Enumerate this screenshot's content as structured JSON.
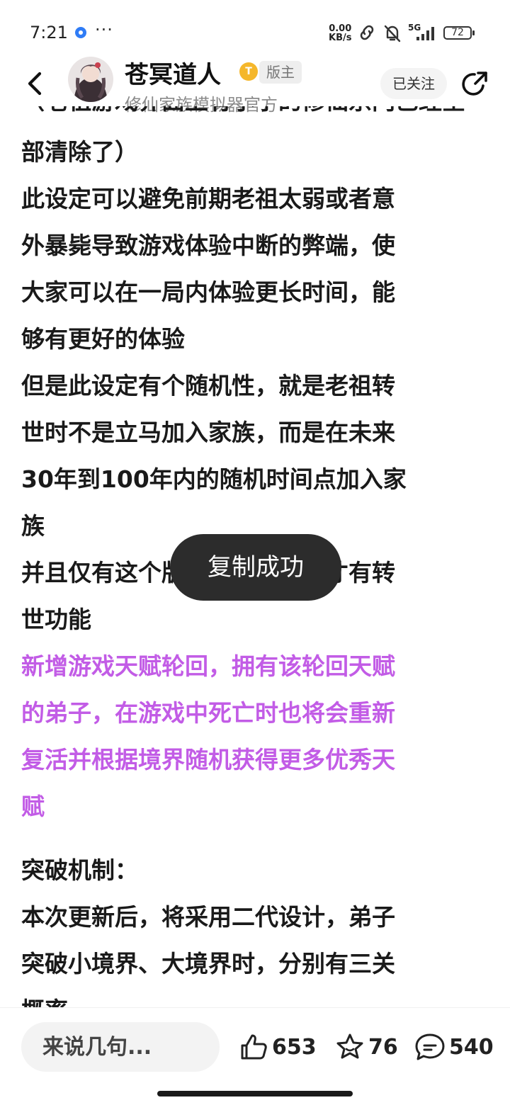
{
  "status_bar": {
    "time": "7:21",
    "net_speed_value": "0.00",
    "net_speed_unit": "KB/s",
    "network_type": "5G",
    "battery": "72"
  },
  "header": {
    "author_name": "苍冥道人",
    "coin_badge": "T",
    "role_badge": "版主",
    "author_subtitle": "修仙家族模拟器官方",
    "follow_label": "已关注"
  },
  "article": {
    "paragraphs": [
      "（老祖游戏界面上有小字的修仙宗门已经全",
      "部清除了）\n此设定可以避免前期老祖太弱或者意\n外暴毙导致游戏体验中断的弊端，使\n大家可以在一局内体验更长时间，能\n够有更好的体验",
      "但是此设定有个随机性，就是老祖转\n世时不是立马加入家族，而是在未来\n30年到100年内的随机时间点加入家\n族",
      "并且仅有这个版本之后的老祖才有转\n世功能",
      "新增游戏天赋轮回，拥有该轮回天赋\n的弟子，在游戏中死亡时也将会重新\n复活并根据境界随机获得更多优秀天\n赋",
      "突破机制：",
      "本次更新后，将采用二代设计，弟子\n突破小境界、大境界时，分别有三关\n概率"
    ],
    "highlight_color": "#c25ce6"
  },
  "toast": {
    "message": "复制成功"
  },
  "bottom_bar": {
    "comment_placeholder": "来说几句...",
    "like_count": "653",
    "favorite_count": "76",
    "comment_count": "540"
  }
}
